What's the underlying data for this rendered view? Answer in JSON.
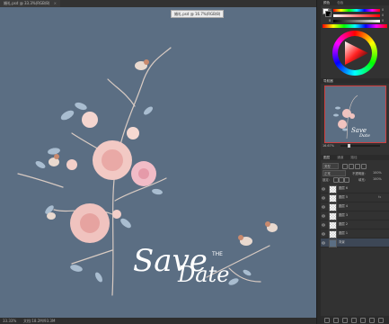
{
  "document": {
    "tab_title": "婚礼.psd @ 33.3%(RGB/8)",
    "tooltip": "婚礼.psd @ 16.7%(RGB/8)",
    "zoom": "33.33%",
    "doc_info": "文档:18.2M/93.3M"
  },
  "artwork": {
    "headline_word1": "Save",
    "headline_small": "THE",
    "headline_word2": "Date"
  },
  "color_panel": {
    "tab_active": "颜色",
    "tab_other": "色板",
    "sliders": [
      {
        "label": "H",
        "value": "0"
      },
      {
        "label": "S",
        "value": "0"
      },
      {
        "label": "B",
        "value": "0"
      }
    ]
  },
  "navigator_panel": {
    "title": "导航器",
    "zoom": "16.67%"
  },
  "layers_panel": {
    "tab_active": "图层",
    "tab_other1": "通道",
    "tab_other2": "路径",
    "kind_label": "类型",
    "blend_mode": "正常",
    "opacity_label": "不透明度:",
    "opacity_value": "100%",
    "lock_label": "锁定:",
    "fill_label": "填充:",
    "fill_value": "100%",
    "layers": [
      {
        "name": "图层 6",
        "fx": ""
      },
      {
        "name": "图层 5",
        "fx": "fx"
      },
      {
        "name": "图层 4",
        "fx": ""
      },
      {
        "name": "图层 3",
        "fx": ""
      },
      {
        "name": "图层 2",
        "fx": ""
      },
      {
        "name": "图层 1",
        "fx": ""
      },
      {
        "name": "背景",
        "fx": ""
      }
    ]
  },
  "colors": {
    "canvas_bg": "#5b6e83",
    "app_bg": "#323232",
    "accent_red": "#d04040"
  }
}
